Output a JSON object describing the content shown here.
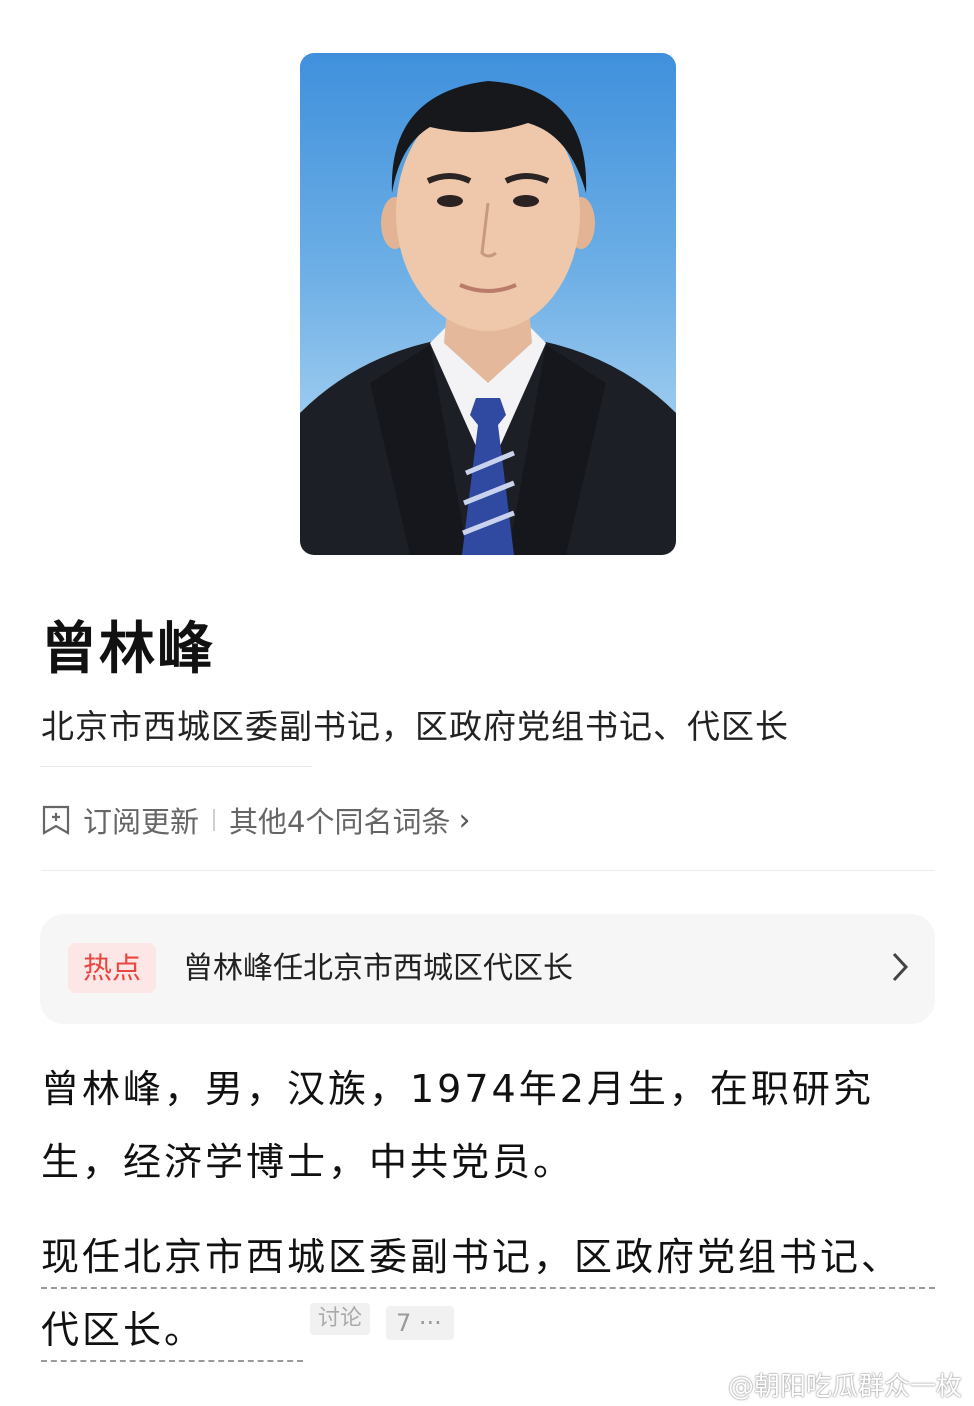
{
  "profile": {
    "name": "曾林峰",
    "subtitle": "北京市西城区委副书记，区政府党组书记、代区长"
  },
  "actions": {
    "subscribe_label": "订阅更新",
    "others_label": "其他4个同名词条",
    "others_chevron": "›"
  },
  "hot": {
    "badge": "热点",
    "text": "曾林峰任北京市西城区代区长"
  },
  "content": {
    "paragraph1": "曾林峰，男，汉族，1974年2月生，在职研究生，经济学博士，中共党员。",
    "paragraph2": "现任北京市西城区委副书记，区政府党组书记、代区长。",
    "discuss_label": "讨论",
    "discuss_count": "7 ···"
  },
  "watermark": "@朝阳吃瓜群众一枚",
  "icons": {
    "subscribe": "bell-icon",
    "hot_arrow": "chevron-right-icon",
    "watermark_logo": "weibo-logo"
  },
  "colors": {
    "hot_red": "#e8473f",
    "hot_badge_bg": "#fde6e6",
    "portrait_sky": "#3f90dc"
  }
}
